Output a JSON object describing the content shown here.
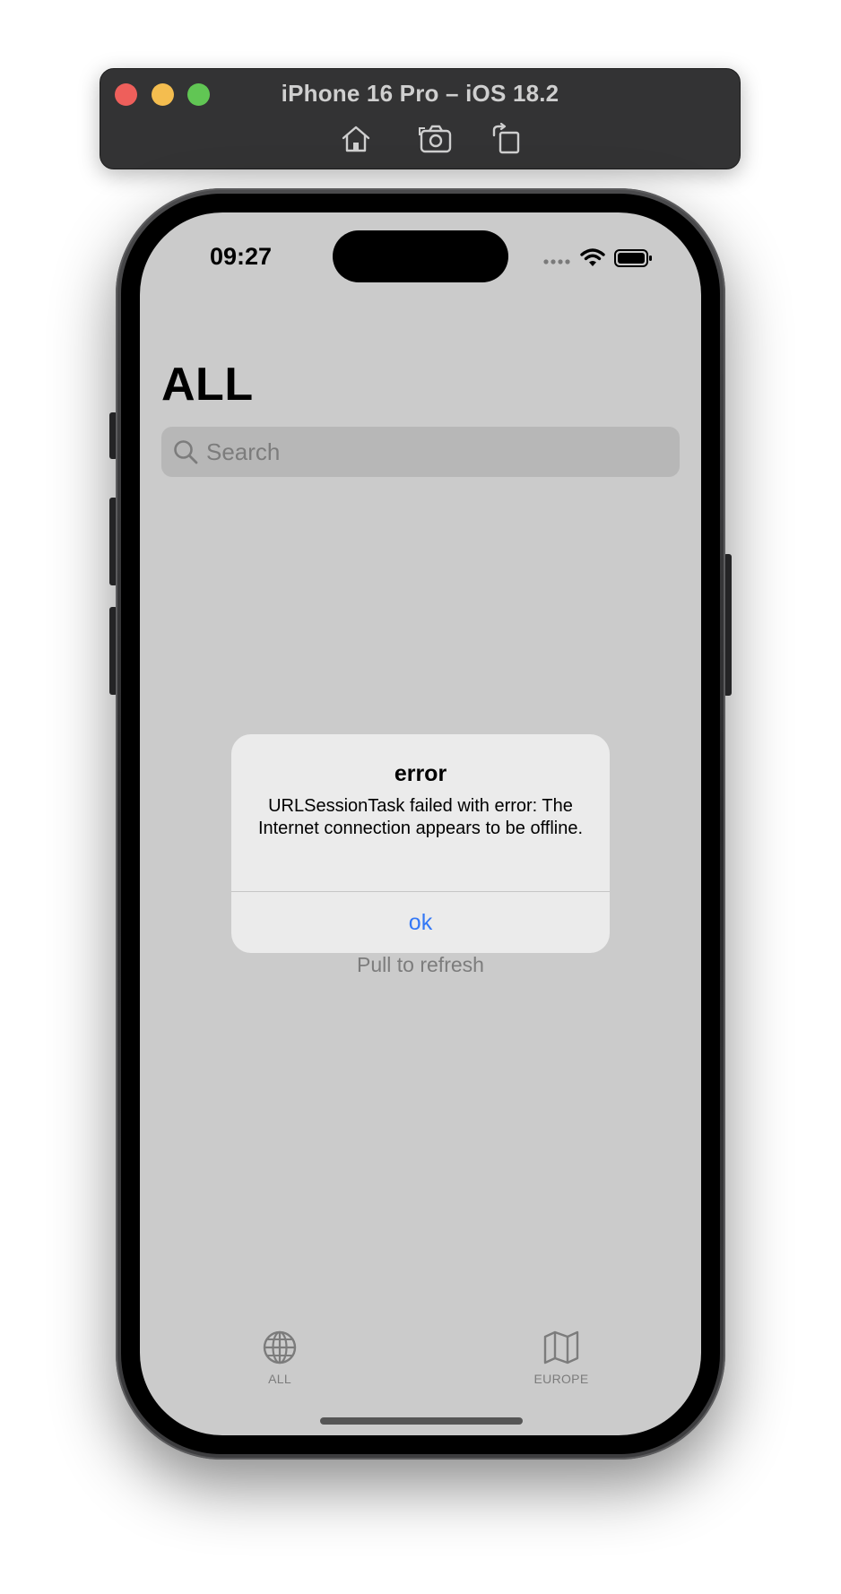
{
  "simulator": {
    "title": "iPhone 16 Pro – iOS 18.2",
    "buttons": [
      "home-icon",
      "screenshot-icon",
      "rotate-icon"
    ]
  },
  "status_bar": {
    "time": "09:27",
    "icons": [
      "cellular-icon",
      "wifi-icon",
      "battery-icon"
    ]
  },
  "page": {
    "title": "ALL"
  },
  "search": {
    "placeholder": "Search",
    "value": ""
  },
  "empty_state": {
    "text": "Pull to refresh"
  },
  "alert": {
    "title": "error",
    "message": "URLSessionTask failed with error: The Internet connection appears to be offline.",
    "button_label": "ok"
  },
  "tab_bar": {
    "items": [
      {
        "label": "ALL",
        "icon": "globe-icon"
      },
      {
        "label": "EUROPE",
        "icon": "map-icon"
      }
    ]
  },
  "colors": {
    "screen_background": "#cbcbcb",
    "alert_button": "#3478f6",
    "traffic_red": "#ee5f5b",
    "traffic_yellow": "#f4bd4f",
    "traffic_green": "#61c654"
  }
}
